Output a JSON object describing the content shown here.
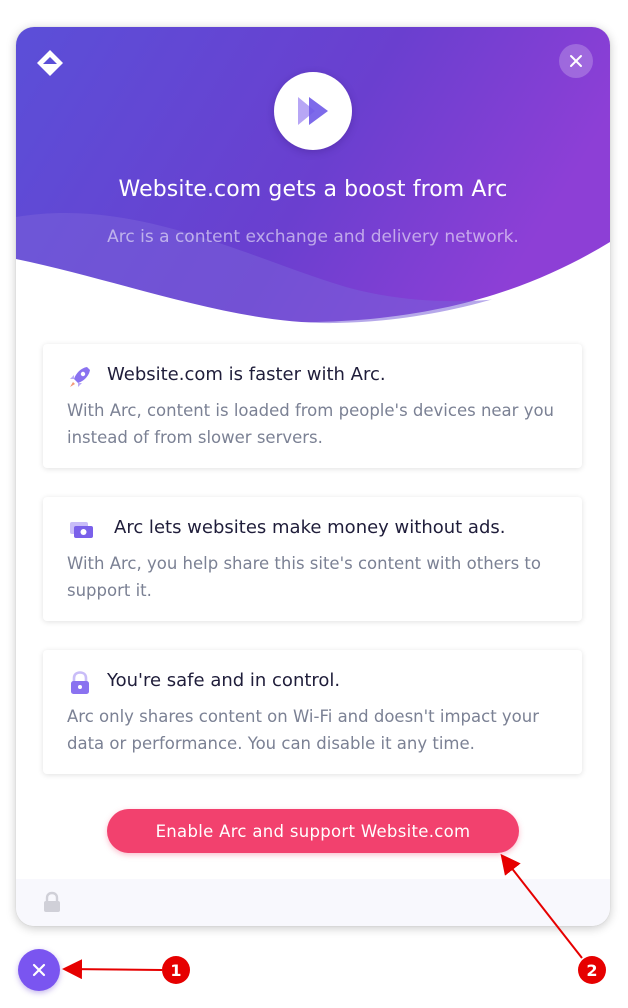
{
  "hero": {
    "title": "Website.com gets a boost from Arc",
    "subtitle": "Arc is a content exchange and delivery network."
  },
  "features": [
    {
      "icon": "rocket-icon",
      "title": "Website.com is faster with Arc.",
      "body": "With Arc, content is loaded from people's devices near you instead of from slower servers."
    },
    {
      "icon": "money-icon",
      "title": "Arc lets websites make money without ads.",
      "body": "With Arc, you help share this site's content with others to support it."
    },
    {
      "icon": "lock-icon",
      "title": "You're safe and in control.",
      "body": "Arc only shares content on Wi-Fi and doesn't impact your data or performance. You can disable it any time."
    }
  ],
  "cta": {
    "label": "Enable Arc and support Website.com"
  },
  "annotations": {
    "marker_1": "1",
    "marker_2": "2"
  },
  "colors": {
    "hero_gradient_start": "#5b4fd8",
    "hero_gradient_end": "#8d3fd6",
    "cta": "#f2416e",
    "fab": "#7a55f0",
    "annotation": "#e60000"
  }
}
